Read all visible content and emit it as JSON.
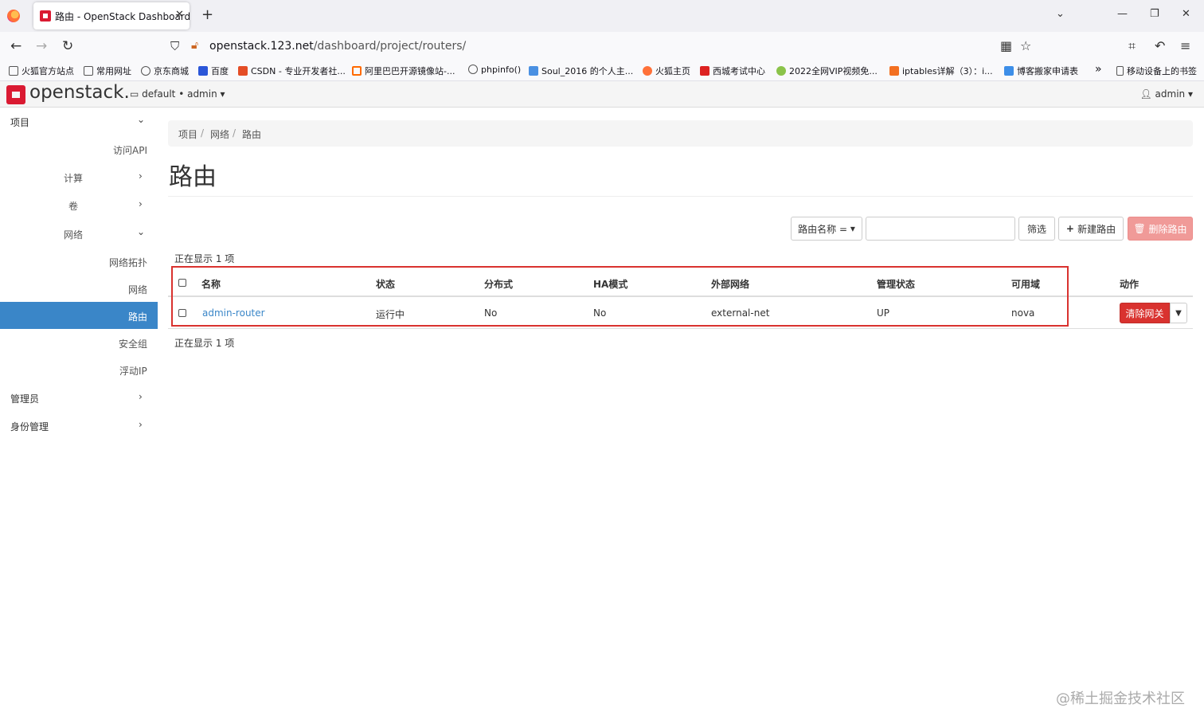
{
  "browser": {
    "tab_title": "路由 - OpenStack Dashboard",
    "tab_close": "✕",
    "new_tab": "+",
    "url_host": "openstack.123.net",
    "url_path": "/dashboard/project/routers/",
    "bookmarks": [
      "火狐官方站点",
      "常用网址",
      "京东商城",
      "百度",
      "CSDN - 专业开发者社...",
      "阿里巴巴开源镜像站-...",
      "phpinfo()",
      "Soul_2016 的个人主...",
      "火狐主页",
      "西城考试中心",
      "2022全网VIP视频免...",
      "iptables详解（3）：i...",
      "博客搬家申请表",
      "移动设备上的书签"
    ],
    "bookmarks_more": "»"
  },
  "header": {
    "logo": "openstack.",
    "project_selector": "default • admin",
    "user": "admin"
  },
  "sidebar": {
    "project": "项目",
    "api_access": "访问API",
    "compute": "计算",
    "volumes": "卷",
    "network": "网络",
    "network_topology": "网络拓扑",
    "networks": "网络",
    "routers": "路由",
    "security_groups": "安全组",
    "floating_ips": "浮动IP",
    "admin": "管理员",
    "identity": "身份管理"
  },
  "breadcrumb": {
    "items": [
      "项目",
      "网络",
      "路由"
    ],
    "sep": "/"
  },
  "page": {
    "title": "路由"
  },
  "toolbar": {
    "filter_field": "路由名称 =",
    "filter_value": "",
    "filter_button": "筛选",
    "create_button": "新建路由",
    "delete_button": "删除路由"
  },
  "table": {
    "count_text": "正在显示 1 项",
    "columns": {
      "name": "名称",
      "status": "状态",
      "distributed": "分布式",
      "ha_mode": "HA模式",
      "external_network": "外部网络",
      "admin_state": "管理状态",
      "availability_zone": "可用域",
      "actions": "动作"
    },
    "rows": [
      {
        "name": "admin-router",
        "status": "运行中",
        "distributed": "No",
        "ha_mode": "No",
        "external_network": "external-net",
        "admin_state": "UP",
        "availability_zone": "nova",
        "action": "清除网关"
      }
    ]
  },
  "watermark": "@稀土掘金技术社区",
  "colors": {
    "primary": "#3a86c8",
    "danger": "#d9322f",
    "brand": "#da1a32"
  }
}
